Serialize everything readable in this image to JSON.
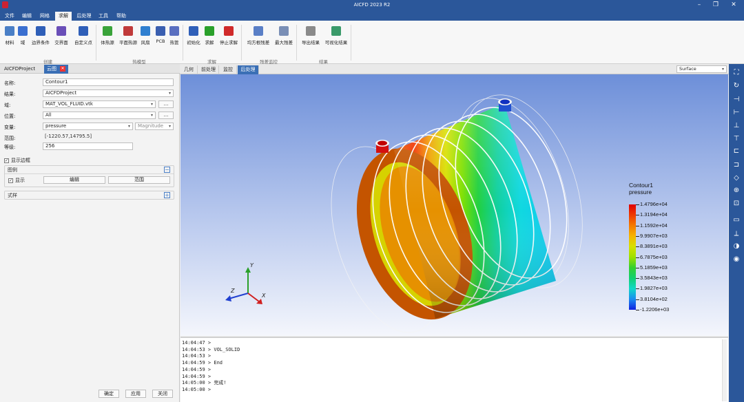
{
  "app": {
    "title": "AICFD 2023 R2"
  },
  "menu": [
    "文件",
    "编辑",
    "网格",
    "求解",
    "后处理",
    "工具",
    "帮助"
  ],
  "ribbon": {
    "buttons": [
      {
        "label": "材料",
        "icon": "material-icon",
        "color": "#4a7fc6"
      },
      {
        "label": "域",
        "icon": "domain-icon",
        "color": "#3a6fd0"
      },
      {
        "label": "边界条件",
        "icon": "boundary-condition-icon",
        "color": "#2f5fb8"
      },
      {
        "label": "交界面",
        "icon": "interface-icon",
        "color": "#6a4fb8"
      },
      {
        "label": "自定义点",
        "icon": "custom-point-icon",
        "color": "#2f5fb8"
      },
      {
        "label": "体热源",
        "icon": "volume-heat-source-icon",
        "color": "#3aa33a"
      },
      {
        "label": "平面热源",
        "icon": "plane-heat-source-icon",
        "color": "#c03a3a"
      },
      {
        "label": "风扇",
        "icon": "fan-icon",
        "color": "#2f7fd0"
      },
      {
        "label": "PCB",
        "icon": "pcb-icon",
        "color": "#3a5fb0"
      },
      {
        "label": "热管",
        "icon": "heat-pipe-icon",
        "color": "#5a6fc0"
      },
      {
        "label": "初始化",
        "icon": "initialize-icon",
        "color": "#2f5fb8"
      },
      {
        "label": "求解",
        "icon": "run-solve-icon",
        "color": "#2aa02a"
      },
      {
        "label": "停止求解",
        "icon": "stop-solve-icon",
        "color": "#d02a2a"
      },
      {
        "label": "均方根残差",
        "icon": "rms-residual-icon",
        "color": "#5a7fc6"
      },
      {
        "label": "最大残差",
        "icon": "max-residual-icon",
        "color": "#7a8fb6"
      },
      {
        "label": "导出结果",
        "icon": "export-result-icon",
        "color": "#8a8a8a"
      },
      {
        "label": "可视化结果",
        "icon": "visualize-result-icon",
        "color": "#3a9a6a"
      }
    ],
    "groups": [
      "创建",
      "热模型",
      "求解",
      "残差监控",
      "结果"
    ]
  },
  "left_panel": {
    "tabs": [
      "AICFDProject",
      "云图"
    ],
    "fields": {
      "name": {
        "label": "名称:",
        "value": "Contour1"
      },
      "result": {
        "label": "结果:",
        "value": "AICFDProject"
      },
      "domain": {
        "label": "域:",
        "value": "MAT_VOL_FLUID.vtk",
        "btn": "..."
      },
      "location": {
        "label": "位置:",
        "value": "All",
        "btn": "..."
      },
      "variable": {
        "label": "变量:",
        "value": "pressure",
        "component": "Magnitude"
      },
      "range": {
        "label": "范围:",
        "value": "[-1220.57,14795.5]"
      },
      "levels": {
        "label": "等级:",
        "value": "256"
      }
    },
    "show_border": {
      "label": "显示边框",
      "checked": true
    },
    "legend_section": {
      "title": "图例",
      "show_label": "显示",
      "edit_label": "编辑",
      "range_label": "范围"
    },
    "style_section": {
      "title": "式样"
    },
    "buttons": {
      "ok": "确定",
      "apply": "应用",
      "close": "关闭"
    }
  },
  "view_tabs": [
    "几何",
    "前处理",
    "监控",
    "后处理"
  ],
  "active_view_tab": "后处理",
  "render_mode": "Surface",
  "legend": {
    "title": "Contour1",
    "variable": "pressure",
    "labels": [
      "1.4796e+04",
      "1.3194e+04",
      "1.1592e+04",
      "9.9907e+03",
      "8.3891e+03",
      "6.7875e+03",
      "5.1859e+03",
      "3.5843e+03",
      "1.9827e+03",
      "3.8104e+02",
      "-1.2206e+03"
    ],
    "colors": [
      "#e00000",
      "#ee3a00",
      "#f47a00",
      "#f6b400",
      "#d6e000",
      "#9ee000",
      "#34d030",
      "#10d070",
      "#10d8c8",
      "#1a8cf0",
      "#1020e0"
    ]
  },
  "axes": {
    "x": "X",
    "y": "Y",
    "z": "Z"
  },
  "console": [
    "14:04:47 >",
    "14:04:53 > VOL_SOLID",
    "14:04:53 >",
    "14:04:59 > End",
    "14:04:59 >",
    "14:04:59 >",
    "14:05:00 > 完成!",
    "14:05:00 >"
  ],
  "toolbar_right": [
    "fit-view-icon",
    "rotate-icon",
    "view-x-icon",
    "view-y-icon",
    "view-z-icon",
    "view-neg-x-icon",
    "view-neg-y-icon",
    "view-neg-z-icon",
    "iso-view-icon",
    "zoom-in-icon",
    "zoom-box-icon",
    "ruler-icon",
    "axis-icon",
    "color-icon",
    "screenshot-icon"
  ]
}
